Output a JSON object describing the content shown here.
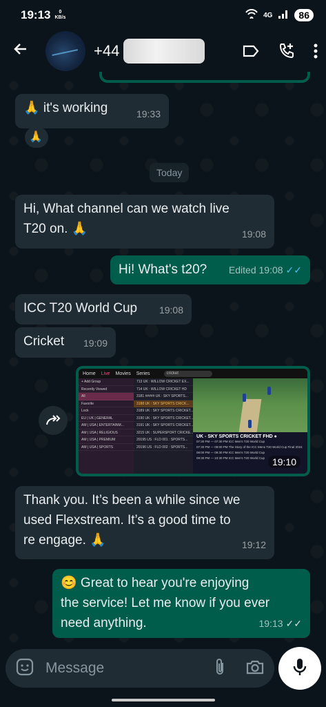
{
  "status": {
    "time": "19:13",
    "speed_value": "0",
    "speed_unit": "KB/s",
    "network": "4G",
    "battery": "86"
  },
  "header": {
    "phone_prefix": "+44"
  },
  "messages": [
    {
      "dir": "in",
      "text": "🙏 it's working",
      "time": "19:33"
    },
    {
      "dir": "reaction",
      "text": "🙏"
    },
    {
      "dir": "date",
      "text": "Today"
    },
    {
      "dir": "in",
      "line1": "Hi, What channel can we watch live",
      "line2": "T20 on. 🙏",
      "time": "19:08"
    },
    {
      "dir": "out",
      "text": "Hi! What's t20?",
      "meta": "Edited 19:08"
    },
    {
      "dir": "in",
      "text": "ICC T20 World Cup",
      "time": "19:08"
    },
    {
      "dir": "in",
      "text": "Cricket",
      "time": "19:09"
    },
    {
      "dir": "image",
      "time": "19:10"
    },
    {
      "dir": "in",
      "line1": "Thank you. It’s been a while since we",
      "line2": "used Flexstream. It’s a good time to",
      "line3": "re engage. 🙏",
      "time": "19:12"
    },
    {
      "dir": "out",
      "line1": "😊 Great to hear you're enjoying",
      "line2": "the service! Let me know if you ever",
      "line3": "need anything.",
      "time": "19:13"
    }
  ],
  "screenshot": {
    "tabs": [
      "Home",
      "Live",
      "Movies",
      "Series"
    ],
    "search": "cricket",
    "groups": [
      "+ Add Group",
      "Recently Viewed",
      "All",
      "Favorite",
      "Lock",
      "EU | UK | GENERAL",
      "AM | USA | ENTERTAINM...",
      "AM | USA | RELIGIOUS",
      "AM | USA | PREMIUM",
      "AM | USA | SPORTS"
    ],
    "channels": [
      "713  UK : WILLOW CRICKET EX...",
      "714  UK : WILLOW CRICKET HD",
      "3181  ##### UK : SKY SPORTS...",
      "3188  UK : SKY SPORTS CRICK...",
      "3189  UK : SKY SPORTS CRICKET...",
      "3190  UK : SKY SPORTS CRICKET...",
      "3191  UK : SKY SPORTS CRICKET...",
      "3215  UK : SUPERSPORT CRICKE...",
      "20195  US : FLD 001 : SPORTS...",
      "20196  US : FLD 002 : SPORTS..."
    ],
    "now_title": "UK - SKY SPORTS CRICKET FHD ●",
    "epg": [
      "07:30 PM — 07:30 PM  ICC Men's T20 World Cup",
      "07:30 PM — 09:00 PM  The Story of the ICC Mens T20 World Cup Final 2024",
      "09:00 PM — 09:30 PM  ICC Men's T20 World Cup",
      "09:30 PM — 10:30 PM  ICC Men's T20 World Cup"
    ]
  },
  "input": {
    "placeholder": "Message"
  }
}
